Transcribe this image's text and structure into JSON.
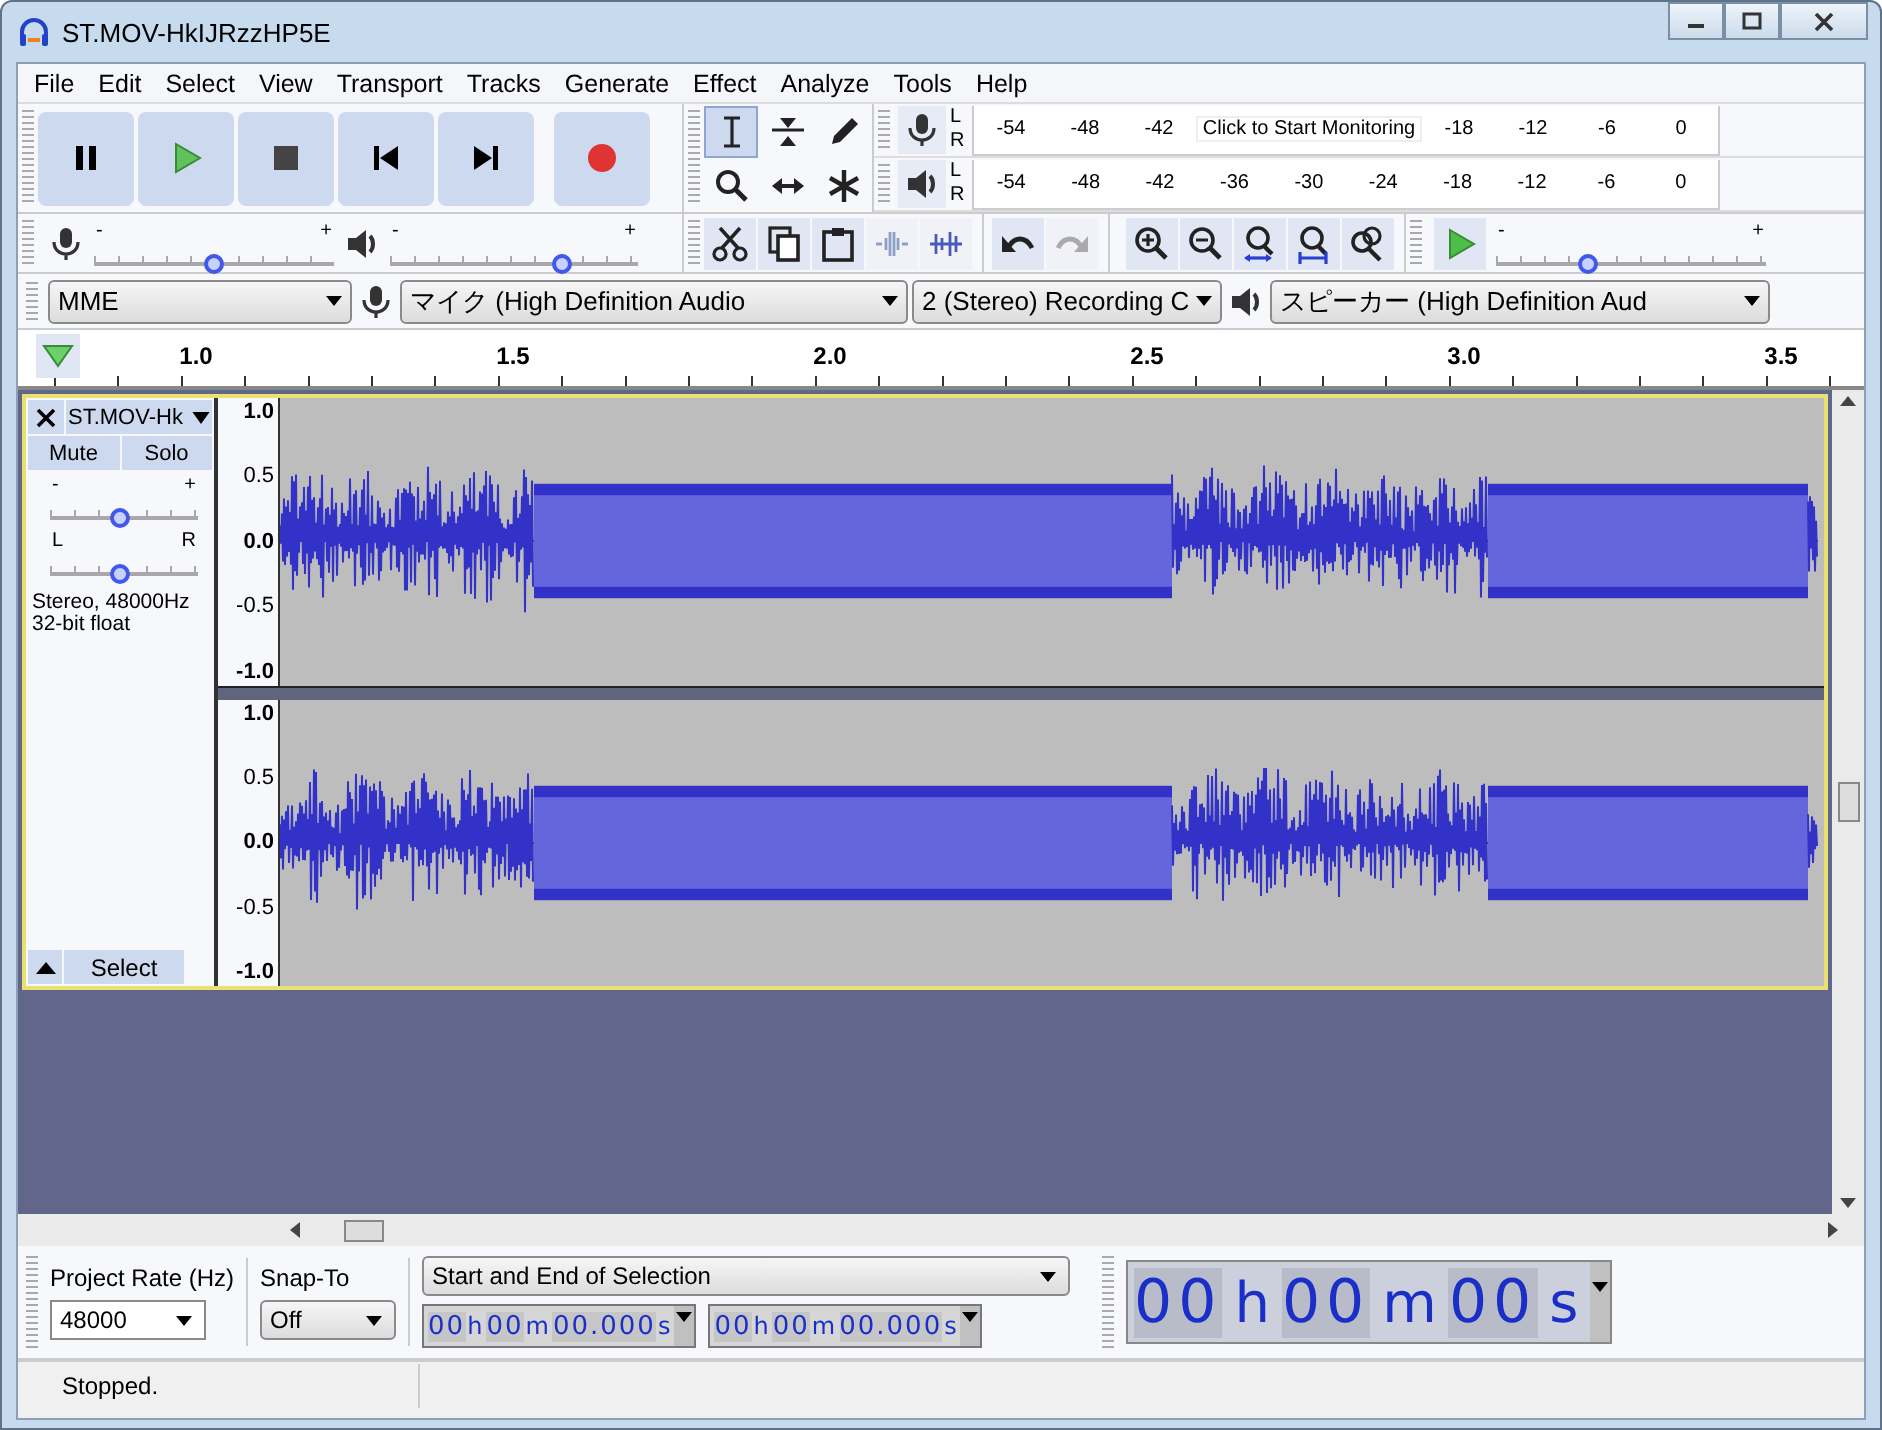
{
  "window": {
    "title": "ST.MOV-HkIJRzzHP5E"
  },
  "menu": [
    "File",
    "Edit",
    "Select",
    "View",
    "Transport",
    "Tracks",
    "Generate",
    "Effect",
    "Analyze",
    "Tools",
    "Help"
  ],
  "tools": [
    {
      "kind": "ibeam",
      "selected": true
    },
    {
      "kind": "envelope",
      "selected": false
    },
    {
      "kind": "pencil",
      "selected": false
    },
    {
      "kind": "zoom",
      "selected": false
    },
    {
      "kind": "timeshift",
      "selected": false
    },
    {
      "kind": "multi",
      "selected": false
    }
  ],
  "meters": [
    {
      "kind": "record",
      "channels": [
        "L",
        "R"
      ],
      "ticks": [
        "-54",
        "-48",
        "-42"
      ],
      "prompt": "Click to Start Monitoring",
      "ticks_after": [
        "-18",
        "-12",
        "-6",
        "0"
      ]
    },
    {
      "kind": "playback",
      "channels": [
        "L",
        "R"
      ],
      "ticks": [
        "-54",
        "-48",
        "-42",
        "-36",
        "-30",
        "-24",
        "-18",
        "-12",
        "-6",
        "0"
      ]
    }
  ],
  "mixer": [
    {
      "kind": "record",
      "min_label": "-",
      "max_label": "+",
      "level": 0.5
    },
    {
      "kind": "playback",
      "min_label": "-",
      "max_label": "+",
      "level": 0.69
    }
  ],
  "play_at_speed": {
    "min_label": "-",
    "max_label": "+",
    "level": 0.34
  },
  "devices": {
    "host": "MME",
    "recording_device": "マイク (High Definition Audio",
    "channels": "2 (Stereo) Recording C",
    "playback_device": "スピーカー (High Definition Aud"
  },
  "ruler": {
    "labels": [
      "1.0",
      "1.5",
      "2.0",
      "2.5",
      "3.0",
      "3.5"
    ]
  },
  "track": {
    "name": "ST.MOV-Hk",
    "mute": "Mute",
    "solo": "Solo",
    "gain": {
      "min_label": "-",
      "max_label": "+",
      "level": 0.47
    },
    "pan": {
      "min_label": "L",
      "max_label": "R",
      "level": 0.47
    },
    "info": [
      "Stereo, 48000Hz",
      "32-bit float"
    ],
    "select": "Select",
    "channels": [
      {
        "scale": [
          "1.0",
          "0.5",
          "0.0",
          "-0.5",
          "-1.0"
        ]
      },
      {
        "scale": [
          "1.0",
          "0.5",
          "0.0",
          "-0.5",
          "-1.0"
        ]
      }
    ]
  },
  "selection_bar": {
    "rate_label": "Project Rate (Hz)",
    "rate": "48000",
    "snap_label": "Snap-To",
    "snap": "Off",
    "mode": "Start and End of Selection",
    "start": [
      {
        "value": "00",
        "unit": "h"
      },
      {
        "value": "00",
        "unit": "m"
      },
      {
        "value": "00.000",
        "unit": "s"
      }
    ],
    "end": [
      {
        "value": "00",
        "unit": "h"
      },
      {
        "value": "00",
        "unit": "m"
      },
      {
        "value": "00.000",
        "unit": "s"
      }
    ],
    "clock": [
      {
        "value": "00",
        "unit": "h"
      },
      {
        "value": "00",
        "unit": "m"
      },
      {
        "value": "00",
        "unit": "s"
      }
    ]
  },
  "status_bar": {
    "text": "Stopped."
  }
}
